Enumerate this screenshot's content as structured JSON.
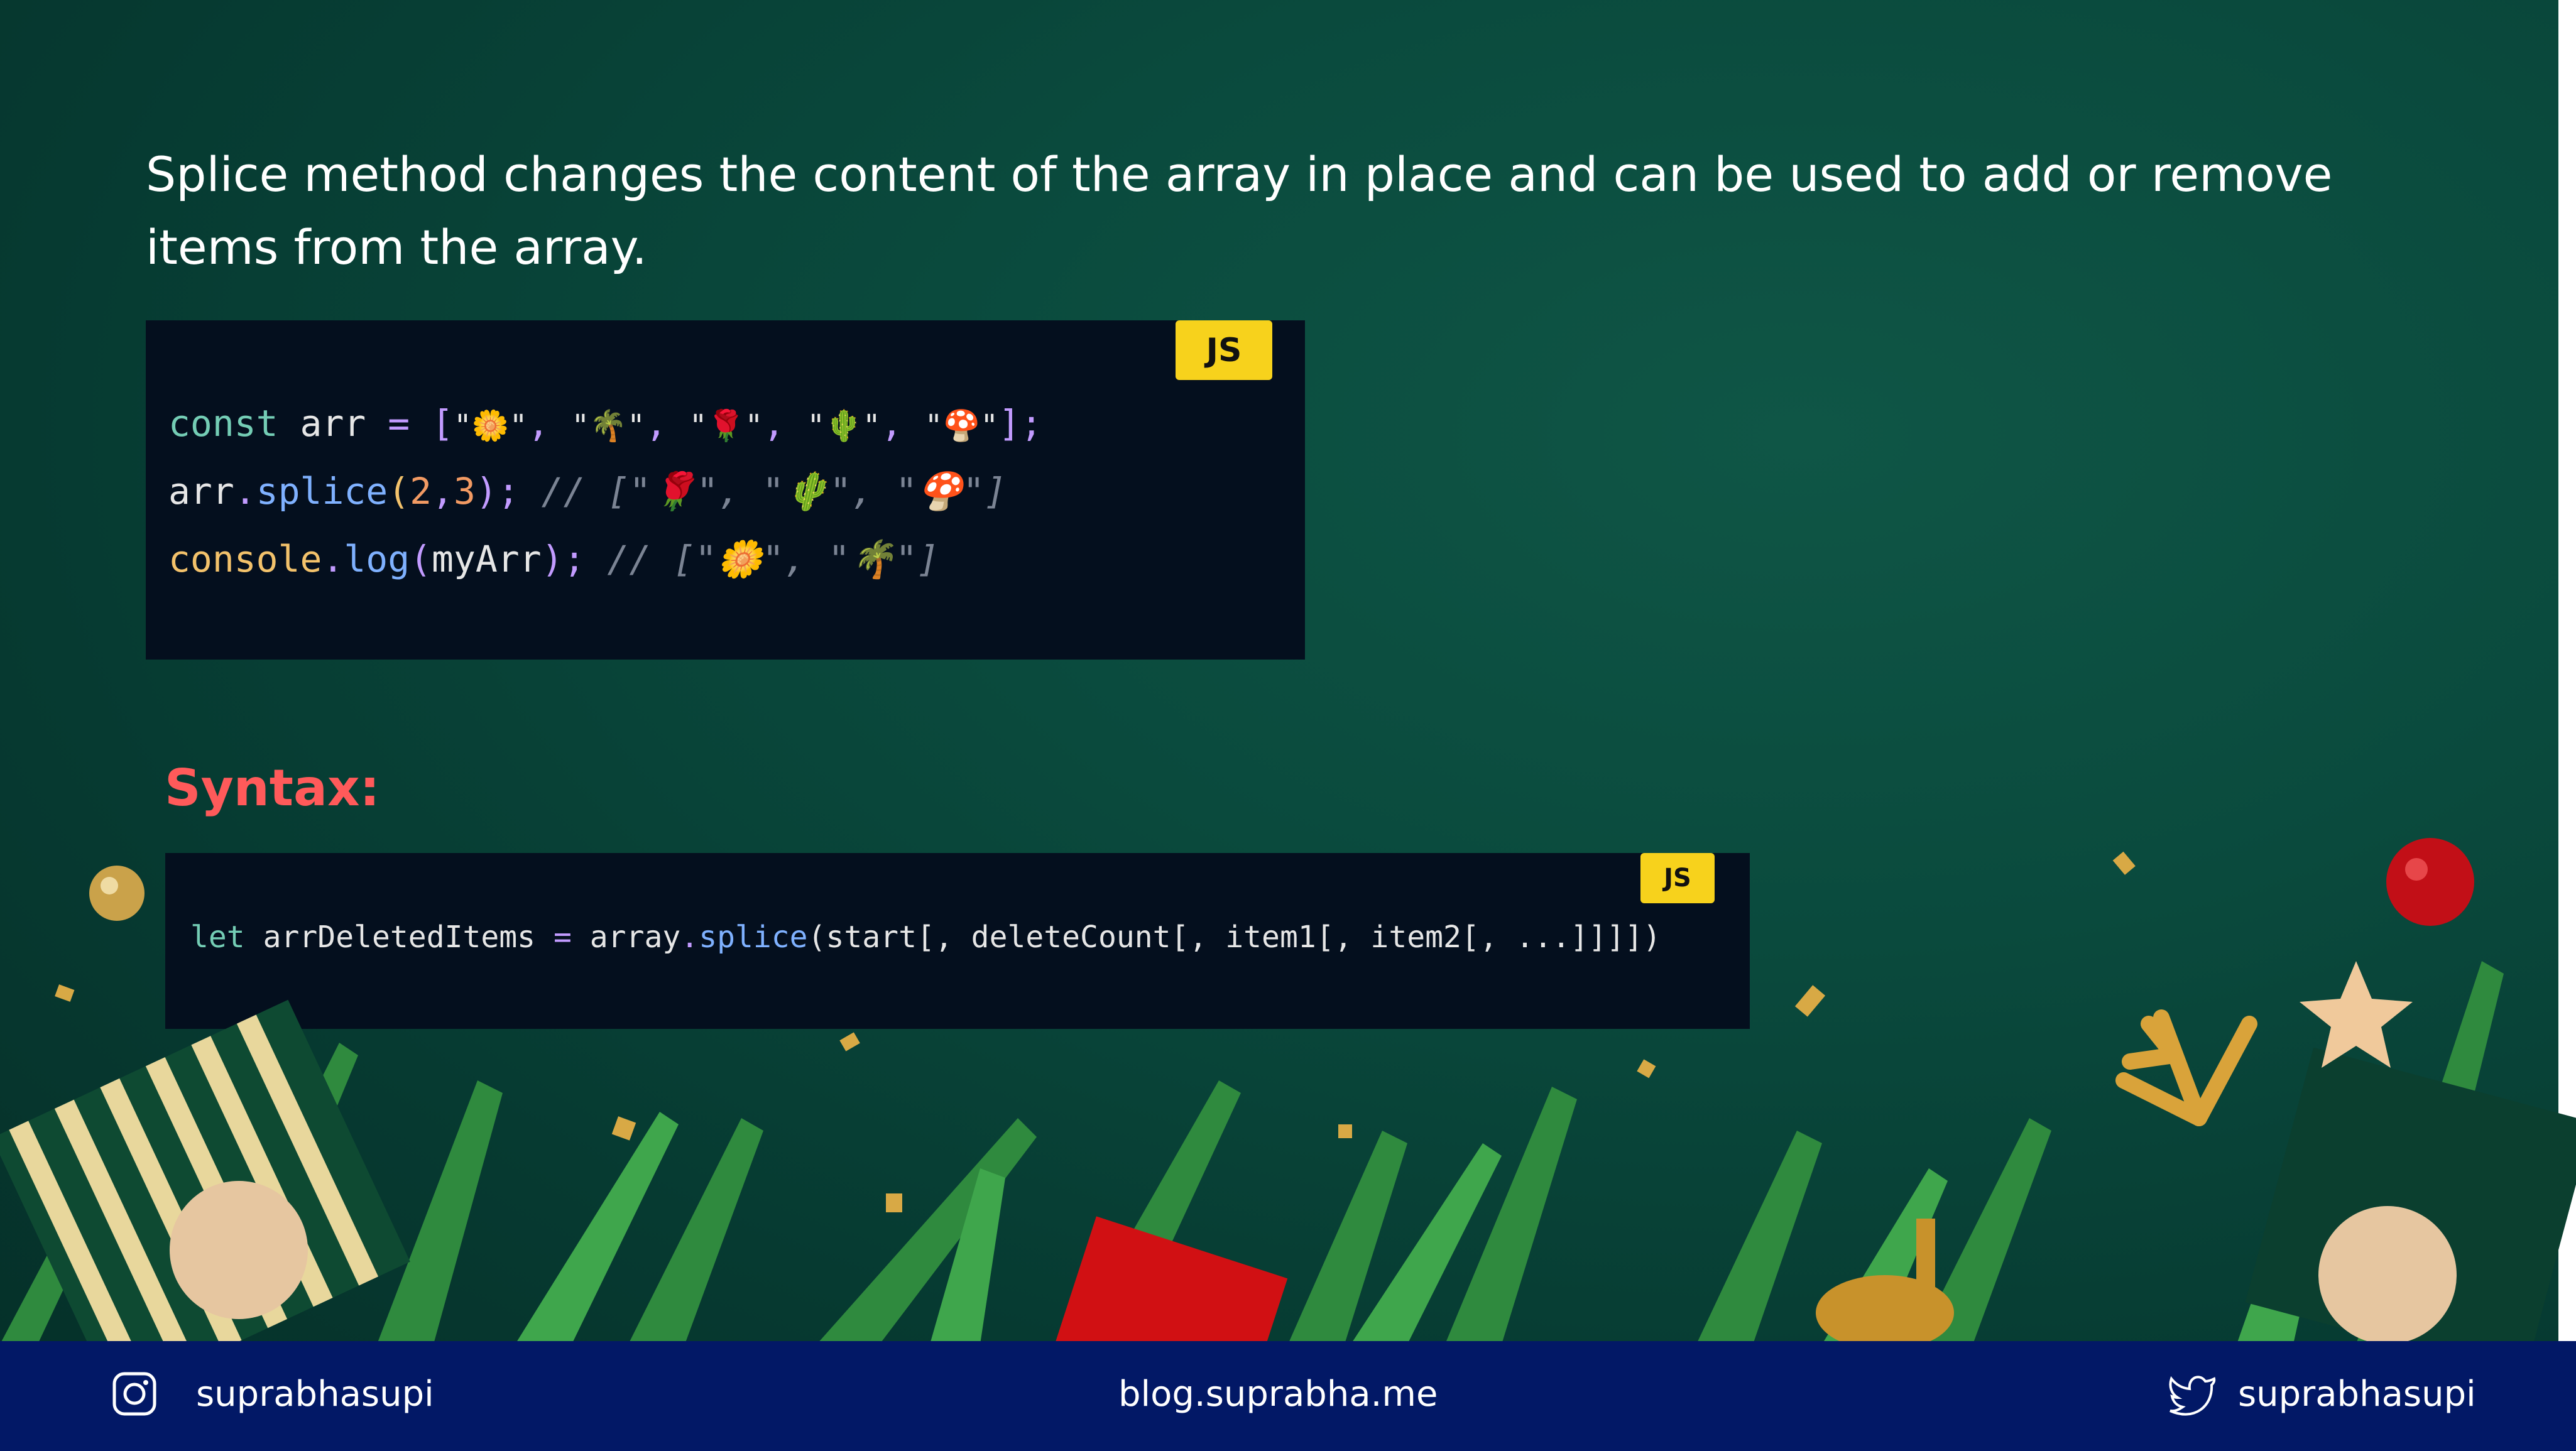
{
  "intro": {
    "text": "Splice method changes the content of the array in place and can be used to add or remove items from the array."
  },
  "code_main": {
    "badge": "JS",
    "line1": {
      "kw": "const",
      "ident": " arr ",
      "op": "= [",
      "items": [
        "\"🌼\"",
        "\"🌴\"",
        "\"🌹\"",
        "\"🌵\"",
        "\"🍄\""
      ],
      "end": "];"
    },
    "line2": {
      "obj": "arr",
      "dot": ".",
      "method": "splice",
      "open": "(",
      "a": "2",
      "comma": ",",
      "b": "3",
      "close": ");",
      "comment": " // [\"🌹\", \"🌵\", \"🍄\"]"
    },
    "line3": {
      "obj": "console",
      "dot": ".",
      "method": "log",
      "open": "(",
      "arg": "myArr",
      "close": ");",
      "comment": " // [\"🌼\", \"🌴\"]"
    }
  },
  "syntax": {
    "title": "Syntax:",
    "badge": "JS",
    "kw": "let",
    "ident": " arrDeletedItems ",
    "eq": "= ",
    "obj": "array",
    "dot": ".",
    "method": "splice",
    "args": "(start[, deleteCount[, item1[, item2[, ...]]]])"
  },
  "footer": {
    "instagram": "suprabhasupi",
    "blog": "blog.suprabha.me",
    "twitter": "suprabhasupi",
    "icons": [
      "instagram-icon",
      "twitter-icon"
    ]
  },
  "colors": {
    "background": "#0a4a3d",
    "footer": "#021866",
    "accent": "#ff5a5a",
    "badge": "#f7d21c",
    "code_bg": "#040f1e"
  }
}
